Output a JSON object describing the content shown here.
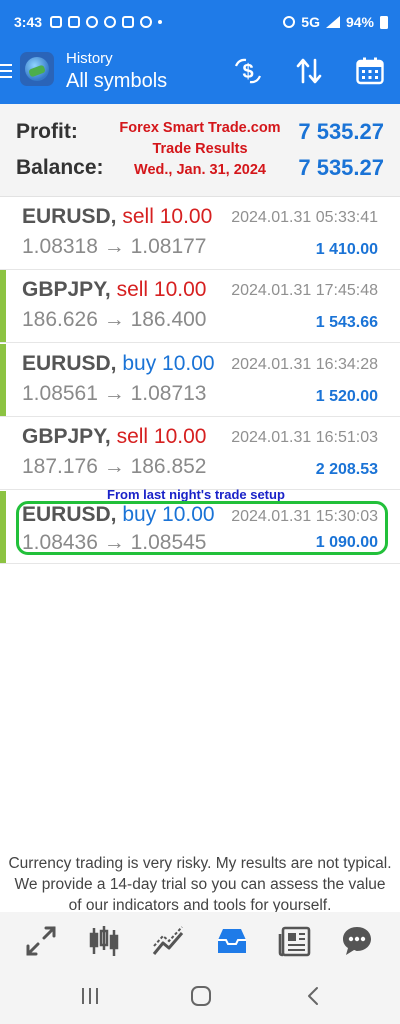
{
  "status_bar": {
    "time": "3:43",
    "network": "5G",
    "battery": "94%"
  },
  "app_bar": {
    "subtitle": "History",
    "title": "All symbols",
    "icons": [
      "menu-icon",
      "app-logo",
      "currency-swap-icon",
      "sort-icon",
      "calendar-icon"
    ]
  },
  "summary": {
    "profit_label": "Profit:",
    "profit_value": "7 535.27",
    "balance_label": "Balance:",
    "balance_value": "7 535.27"
  },
  "overlay": {
    "line1": "Forex Smart Trade.com",
    "line2": "Trade Results",
    "line3": "Wed., Jan. 31, 2024"
  },
  "trades": [
    {
      "symbol": "EURUSD,",
      "action": "sell 10.00",
      "prices": "1.08318 → 1.08177",
      "datetime": "2024.01.31 05:33:41",
      "profit": "1 410.00"
    },
    {
      "symbol": "GBPJPY,",
      "action": "sell 10.00",
      "prices": "186.626 → 186.400",
      "datetime": "2024.01.31 17:45:48",
      "profit": "1 543.66"
    },
    {
      "symbol": "EURUSD,",
      "action": "buy 10.00",
      "prices": "1.08561 → 1.08713",
      "datetime": "2024.01.31 16:34:28",
      "profit": "1 520.00"
    },
    {
      "symbol": "GBPJPY,",
      "action": "sell 10.00",
      "prices": "187.176 → 186.852",
      "datetime": "2024.01.31 16:51:03",
      "profit": "2 208.53"
    },
    {
      "symbol": "EURUSD,",
      "action": "buy 10.00",
      "prices": "1.08436 → 1.08545",
      "datetime": "2024.01.31 15:30:03",
      "profit": "1 090.00"
    }
  ],
  "annotation": "From last night's trade setup",
  "disclaimer": "Currency trading is very risky. My results are not typical. We provide a 14-day trial so you can assess the value of our indicators and tools for yourself.",
  "bottom_nav": [
    "trade-icon",
    "candles-icon",
    "chart-icon",
    "history-icon",
    "news-icon",
    "chat-icon"
  ],
  "colors": {
    "accent": "#1f7be8",
    "sell": "#d62020",
    "buy": "#1a73d6",
    "profit_stripe": "#8cc342",
    "highlight": "#22c03a",
    "overlay_text": "#d4161a",
    "annotation": "#1a22c8"
  }
}
